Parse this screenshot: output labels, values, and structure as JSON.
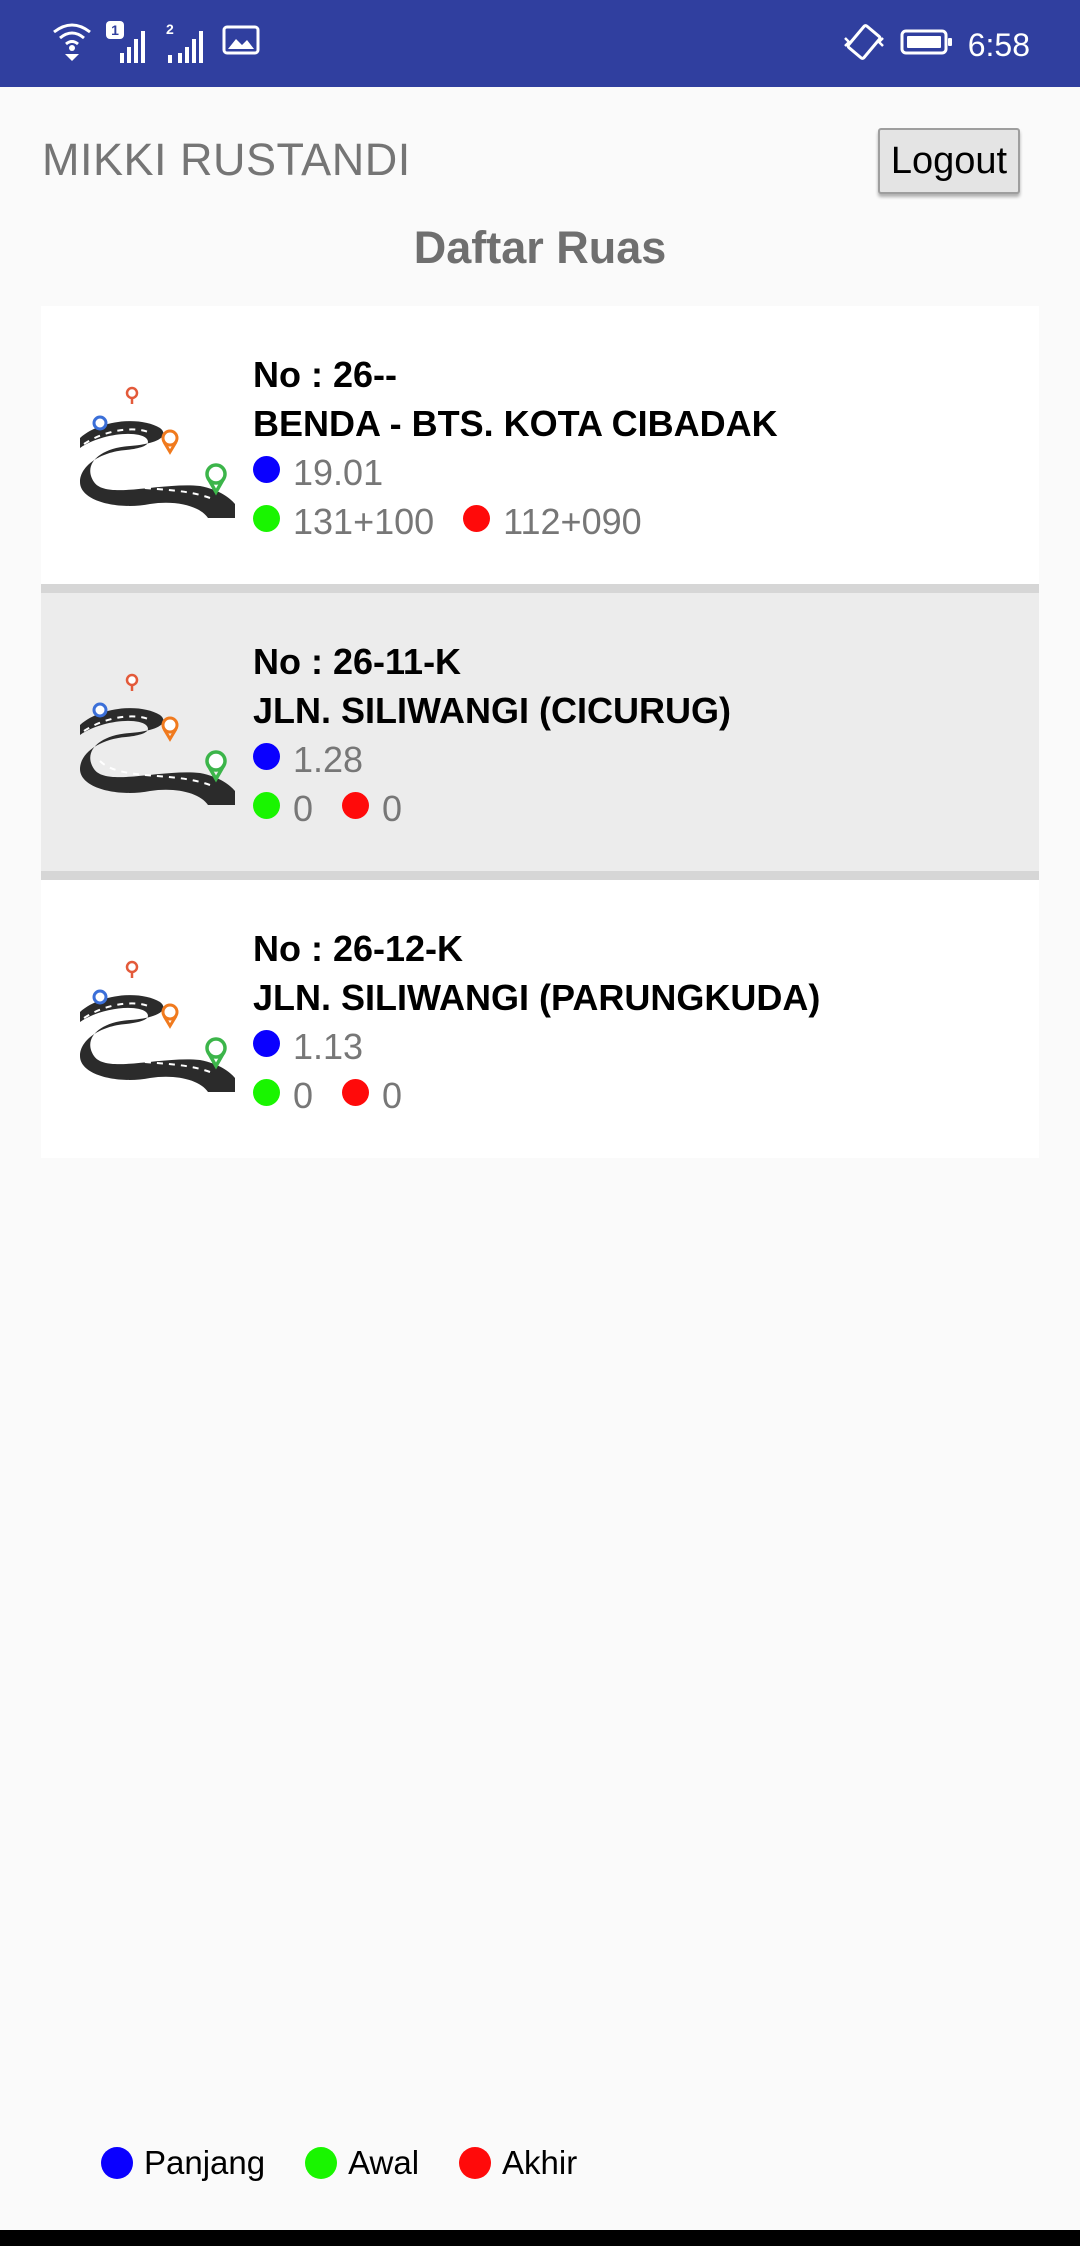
{
  "status_bar": {
    "time": "6:58",
    "sim1_badge": "1",
    "sim2_badge": "2",
    "colors": {
      "background": "#303f9f"
    }
  },
  "header": {
    "user_name": "MIKKI RUSTANDI",
    "logout_label": "Logout"
  },
  "page": {
    "title": "Daftar Ruas"
  },
  "ruas": [
    {
      "no": "No : 26--",
      "name": "BENDA - BTS. KOTA CIBADAK",
      "panjang": "19.01",
      "awal": "131+100",
      "akhir": "112+090"
    },
    {
      "no": "No : 26-11-K",
      "name": "JLN. SILIWANGI (CICURUG)",
      "panjang": "1.28",
      "awal": "0",
      "akhir": "0"
    },
    {
      "no": "No : 26-12-K",
      "name": "JLN. SILIWANGI (PARUNGKUDA)",
      "panjang": "1.13",
      "awal": "0",
      "akhir": "0"
    }
  ],
  "legend": {
    "panjang": "Panjang",
    "awal": "Awal",
    "akhir": "Akhir"
  },
  "icons": [
    "wifi-icon",
    "signal-icon",
    "image-icon",
    "vibrate-icon",
    "battery-icon",
    "road-icon"
  ],
  "colors": {
    "panjang": "#0a00ff",
    "awal": "#19f500",
    "akhir": "#ff0a0a"
  }
}
